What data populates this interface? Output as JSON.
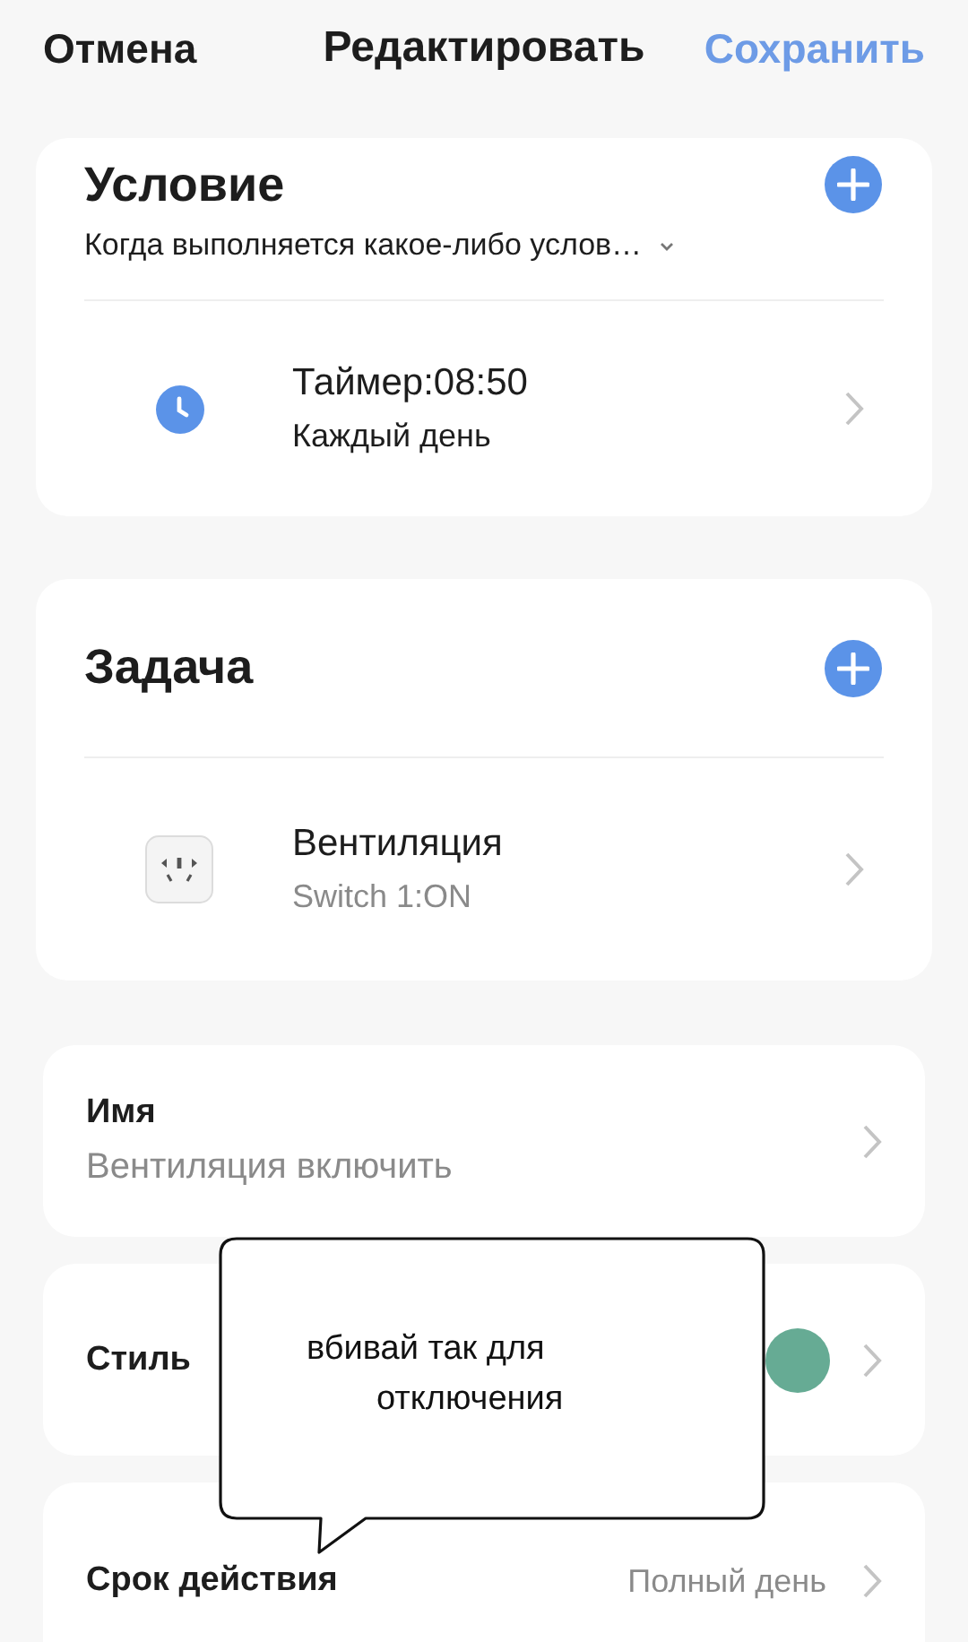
{
  "header": {
    "cancel": "Отмена",
    "title": "Редактировать",
    "save": "Сохранить"
  },
  "condition": {
    "title": "Условие",
    "mode": "Когда выполняется какое-либо услов…",
    "items": [
      {
        "kind": "timer",
        "title": "Таймер:08:50",
        "subtitle": "Каждый день"
      }
    ]
  },
  "task": {
    "title": "Задача",
    "items": [
      {
        "kind": "device",
        "title": "Вентиляция",
        "subtitle": "Switch 1:ON"
      }
    ]
  },
  "settings": [
    {
      "kind": "text",
      "label": "Имя",
      "value": "Вентиляция включить"
    },
    {
      "kind": "color",
      "label": "Стиль",
      "color": "#66ab94"
    },
    {
      "kind": "inline",
      "label": "Срок действия",
      "value": "Полный день"
    }
  ],
  "callout": {
    "lines": [
      "вбивай так для",
      "отключения"
    ]
  }
}
